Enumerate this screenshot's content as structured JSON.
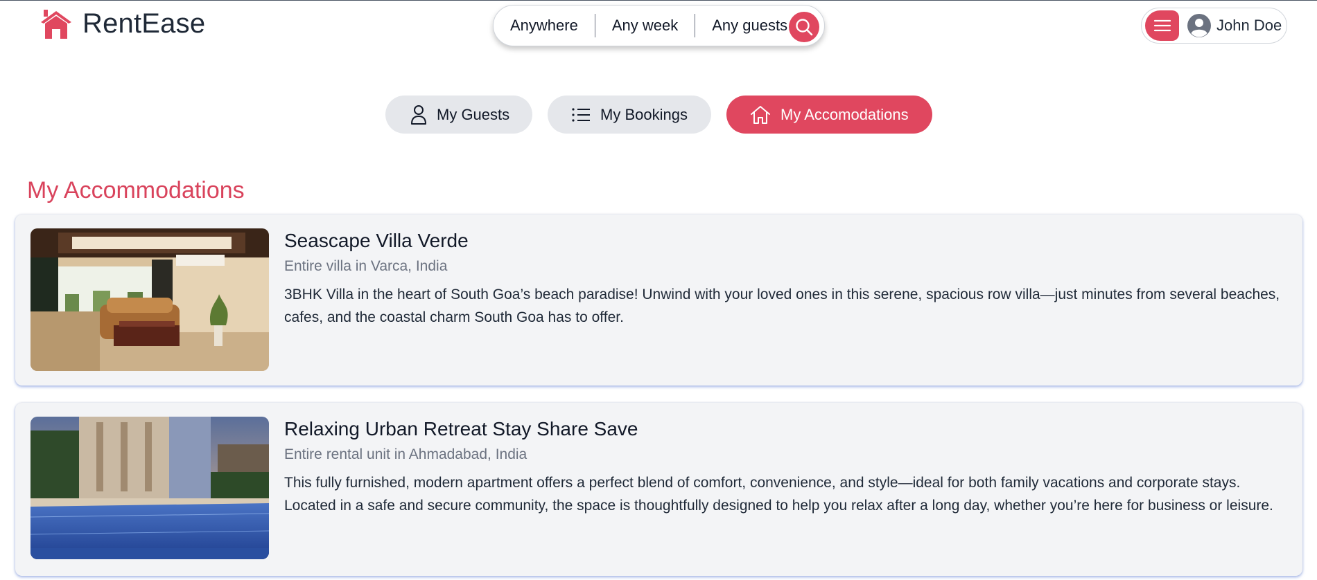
{
  "app": {
    "name": "RentEase"
  },
  "search": {
    "where": "Anywhere",
    "when": "Any week",
    "who": "Any guests"
  },
  "user": {
    "name": "John Doe"
  },
  "tabs": [
    {
      "label": "My Guests",
      "icon": "user-icon",
      "active": false
    },
    {
      "label": "My Bookings",
      "icon": "list-icon",
      "active": false
    },
    {
      "label": "My Accomodations",
      "icon": "home-icon",
      "active": true
    }
  ],
  "section_title": "My Accommodations",
  "accommodations": [
    {
      "title": "Seascape Villa Verde",
      "location": "Entire villa in Varca, India",
      "description": "3BHK Villa in the heart of South Goa’s beach paradise! Unwind with your loved ones in this serene, spacious row villa—just minutes from several beaches, cafes, and the coastal charm South Goa has to offer."
    },
    {
      "title": "Relaxing Urban Retreat Stay Share Save",
      "location": "Entire rental unit in Ahmadabad, India",
      "description": "This fully furnished, modern apartment offers a perfect blend of comfort, convenience, and style—ideal for both family vacations and corporate stays. Located in a safe and secure community, the space is thoughtfully designed to help you relax after a long day, whether you’re here for business or leisure."
    }
  ],
  "colors": {
    "accent": "#e0475f",
    "tab_inactive": "#e5e7eb",
    "card_background": "#f3f4f6"
  }
}
